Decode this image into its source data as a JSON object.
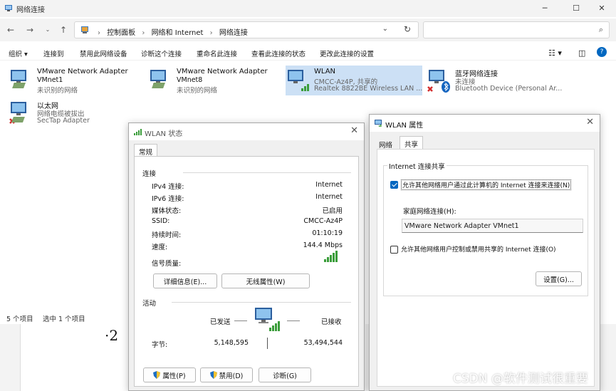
{
  "window": {
    "title": "网络连接"
  },
  "breadcrumb": [
    "控制面板",
    "网络和 Internet",
    "网络连接"
  ],
  "toolbar": {
    "organize": "组织 ▾",
    "items": [
      "连接到",
      "禁用此网络设备",
      "诊断这个连接",
      "重命名此连接",
      "查看此连接的状态",
      "更改此连接的设置"
    ]
  },
  "adapters": [
    {
      "name": "VMware Network Adapter VMnet1",
      "line1": "VMware Network Adapter",
      "line2": "VMnet1",
      "line3": "未识别的网络"
    },
    {
      "name": "VMware Network Adapter VMnet8",
      "line1": "VMware Network Adapter",
      "line2": "VMnet8",
      "line3": "未识别的网络"
    },
    {
      "name": "WLAN",
      "line1": "WLAN",
      "line2": "CMCC-Az4P, 共享的",
      "line3": "Realtek 8822BE Wireless LAN ..."
    },
    {
      "name": "蓝牙网络连接",
      "line1": "蓝牙网络连接",
      "line2": "未连接",
      "line3": "Bluetooth Device (Personal Ar..."
    },
    {
      "name": "以太网",
      "line1": "以太网",
      "line2": "网络电缆被拔出",
      "line3": "SecTap Adapter"
    }
  ],
  "status": {
    "count": "5 个项目",
    "selected": "选中 1 个项目"
  },
  "background_doc": {
    "text": "·2"
  },
  "wlan_status": {
    "title": "WLAN 状态",
    "tab": "常规",
    "connection_group": "连接",
    "rows": [
      {
        "k": "IPv4 连接:",
        "v": "Internet"
      },
      {
        "k": "IPv6 连接:",
        "v": "Internet"
      },
      {
        "k": "媒体状态:",
        "v": "已启用"
      },
      {
        "k": "SSID:",
        "v": "CMCC-Az4P"
      },
      {
        "k": "持续时间:",
        "v": "01:10:19"
      },
      {
        "k": "速度:",
        "v": "144.4 Mbps"
      }
    ],
    "signal_label": "信号质量:",
    "details_btn": "详细信息(E)...",
    "wireless_btn": "无线属性(W)",
    "activity_group": "活动",
    "sent_label": "已发送",
    "recv_label": "已接收",
    "bytes_label": "字节:",
    "sent_bytes": "5,148,595",
    "recv_bytes": "53,494,544",
    "properties_btn": "属性(P)",
    "disable_btn": "禁用(D)",
    "diagnose_btn": "诊断(G)"
  },
  "wlan_props": {
    "title": "WLAN 属性",
    "tabs": [
      "网络",
      "共享"
    ],
    "group": "Internet 连接共享",
    "allow_share": "允许其他网络用户通过此计算机的 Internet 连接来连接(N)",
    "allow_share_checked": true,
    "home_label": "家庭网络连接(H):",
    "home_value": "VMware Network Adapter VMnet1",
    "allow_control": "允许其他网络用户控制或禁用共享的 Internet 连接(O)",
    "allow_control_checked": false,
    "settings_btn": "设置(G)..."
  },
  "watermark": "CSDN @软件测试很重要",
  "colors": {
    "accent": "#0067c0",
    "selected": "#cce0f5",
    "signal": "#3a9d3a",
    "error": "#d32f2f"
  }
}
